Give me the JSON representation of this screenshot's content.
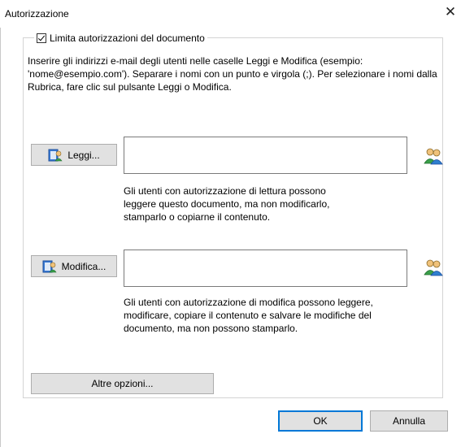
{
  "window": {
    "title": "Autorizzazione"
  },
  "restrict": {
    "label": "Limita autorizzazioni del documento",
    "checked": true
  },
  "instructions": "Inserire gli indirizzi e-mail degli utenti nelle caselle Leggi e Modifica (esempio: 'nome@esempio.com'). Separare i nomi con un punto e virgola (;). Per selezionare i nomi dalla Rubrica, fare clic sul pulsante Leggi o Modifica.",
  "read": {
    "button_label": "Leggi...",
    "value": "",
    "description": "Gli utenti con autorizzazione di lettura possono leggere questo documento, ma non modificarlo, stamparlo o copiarne il contenuto."
  },
  "change": {
    "button_label": "Modifica...",
    "value": "",
    "description": "Gli utenti con autorizzazione di modifica possono leggere, modificare, copiare il contenuto e salvare le modifiche del documento, ma non possono stamparlo."
  },
  "more_options_label": "Altre opzioni...",
  "ok_label": "OK",
  "cancel_label": "Annulla"
}
